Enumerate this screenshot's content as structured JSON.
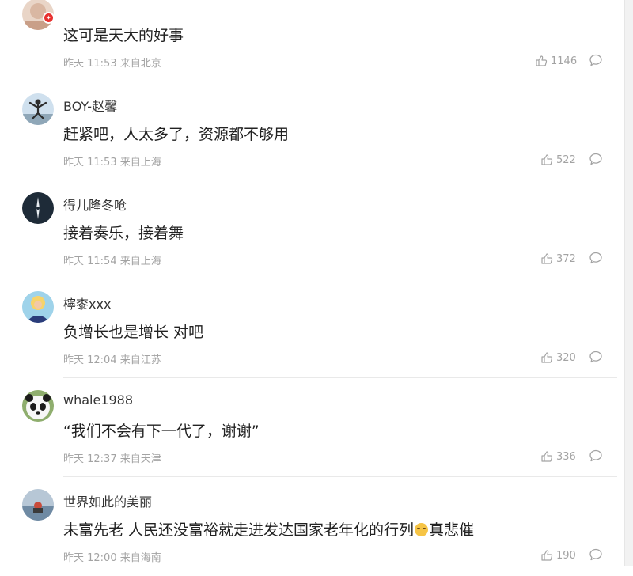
{
  "comments": [
    {
      "username": "",
      "content": "这可是天大的好事",
      "time": "昨天 11:53",
      "location": "来自北京",
      "likes": "1146",
      "like_icon": "thumbs-up-icon",
      "reply_icon": "comment-bubble-icon"
    },
    {
      "username": "BOY-赵馨",
      "content": "赶紧吧，人太多了，资源都不够用",
      "time": "昨天 11:53",
      "location": "来自上海",
      "likes": "522"
    },
    {
      "username": "得儿隆冬呛",
      "content": "接着奏乐，接着舞",
      "time": "昨天 11:54",
      "location": "来自上海",
      "likes": "372"
    },
    {
      "username": "檸桼xxx",
      "content": "负增长也是增长 对吧",
      "time": "昨天 12:04",
      "location": "来自江苏",
      "likes": "320"
    },
    {
      "username": "whale1988",
      "content": "“我们不会有下一代了，谢谢”",
      "time": "昨天 12:37",
      "location": "来自天津",
      "likes": "336"
    },
    {
      "username": "世界如此的美丽",
      "content_before_emoji": "未富先老 人民还没富裕就走进发达国家老年化的行列",
      "content_after_emoji": "真悲催",
      "emoji": "sad-face-emoji",
      "time": "昨天 12:00",
      "location": "来自海南",
      "likes": "190"
    }
  ],
  "colors": {
    "meta_text": "#a3a3a3",
    "body_text": "#222222",
    "badge_red": "#e8312f"
  }
}
